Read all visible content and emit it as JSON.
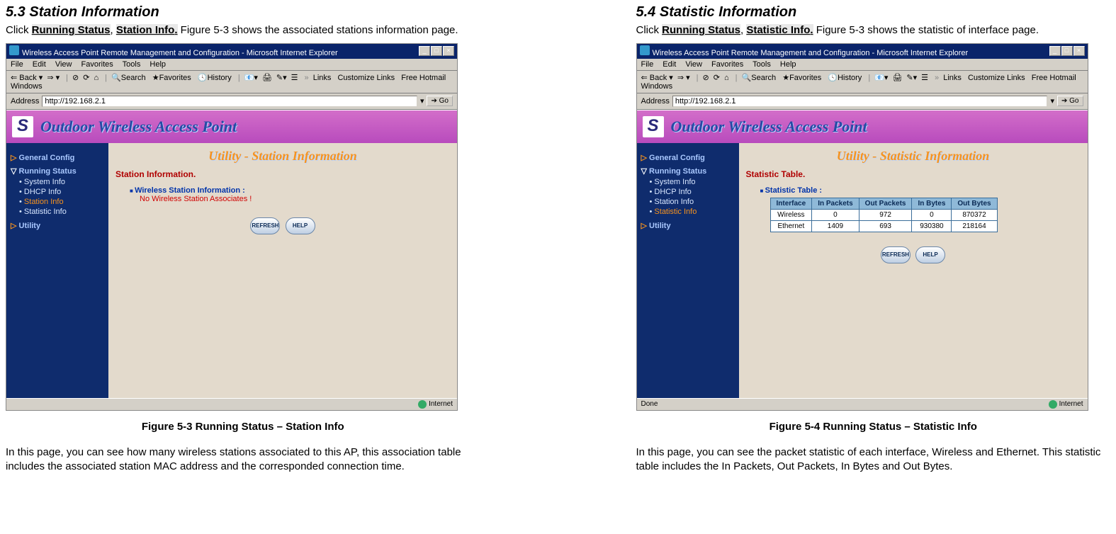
{
  "left": {
    "heading": "5.3    Station Information",
    "intro_prefix": "Click ",
    "link1": "Running Status",
    "sep": ", ",
    "link2": "Station Info",
    "dot": ".",
    "intro_suffix": " Figure 5-3 shows the associated stations information page.",
    "caption": "Figure 5-3   Running Status – Station Info",
    "desc": "In this page, you can see how many wireless stations associated to this AP, this association table includes the associated station MAC address and the corresponded connection time."
  },
  "right": {
    "heading": "5.4    Statistic Information",
    "intro_prefix": "Click ",
    "link1": "Running Status",
    "sep": ", ",
    "link2": "Statistic Info",
    "dot": ".",
    "intro_suffix": " Figure 5-3 shows the statistic of interface page.",
    "caption": "Figure 5-4   Running Status – Statistic Info",
    "desc": "In this page, you can see the packet statistic of each interface, Wireless and Ethernet. This statistic table includes the In Packets, Out Packets, In Bytes and Out Bytes."
  },
  "ie": {
    "title": "Wireless Access Point Remote Management and Configuration - Microsoft Internet Explorer",
    "menus": [
      "File",
      "Edit",
      "View",
      "Favorites",
      "Tools",
      "Help"
    ],
    "toolbar": {
      "back": "Back",
      "search": "Search",
      "favorites": "Favorites",
      "history": "History",
      "links": "Links",
      "customize": "Customize Links",
      "freehotmail": "Free Hotmail",
      "windows": "Windows"
    },
    "address_label": "Address",
    "url": "http://192.168.2.1",
    "go": "Go",
    "banner": "Outdoor Wireless Access Point",
    "logo": "S",
    "sidebar": {
      "general": "General Config",
      "running": "Running Status",
      "items_station": [
        "System Info",
        "DHCP Info",
        "Station Info",
        "Statistic Info"
      ],
      "items_statistic": [
        "System Info",
        "DHCP Info",
        "Station Info",
        "Statistic Info"
      ],
      "utility": "Utility"
    },
    "station": {
      "title": "Utility - Station Information",
      "section": "Station Information.",
      "sub": "Wireless Station Information :",
      "msg": "No Wireless Station Associates !",
      "btn_refresh": "REFRESH",
      "btn_help": "HELP",
      "status_left": "",
      "status_right": "Internet"
    },
    "statistic": {
      "title": "Utility - Statistic Information",
      "section": "Statistic Table.",
      "sub": "Statistic Table :",
      "headers": [
        "Interface",
        "In Packets",
        "Out Packets",
        "In Bytes",
        "Out Bytes"
      ],
      "rows": [
        [
          "Wireless",
          "0",
          "972",
          "0",
          "870372"
        ],
        [
          "Ethernet",
          "1409",
          "693",
          "930380",
          "218164"
        ]
      ],
      "btn_refresh": "REFRESH",
      "btn_help": "HELP",
      "status_left": "Done",
      "status_right": "Internet"
    }
  }
}
